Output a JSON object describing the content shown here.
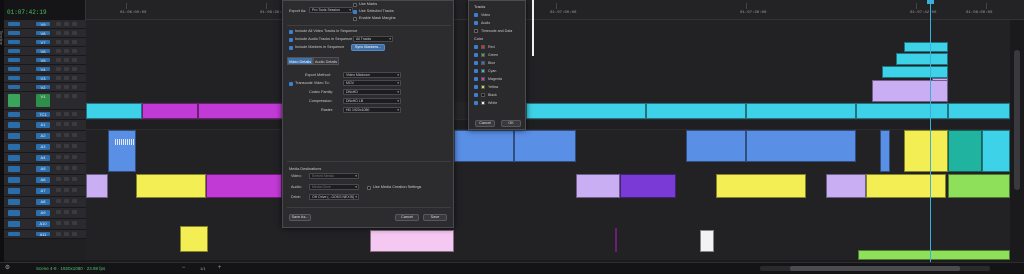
{
  "app": {
    "sidebar_label": "Timeline",
    "timecode": "01:07:42:19",
    "status_text": "Scene 4-8 · 1920x1080 · 23.98 fps",
    "zoom_value": "1/1"
  },
  "ruler": {
    "labels": [
      "01:06:00:00",
      "01:06:30:00",
      "01:07:00:00",
      "01:07:30:00",
      "01:07:42:00",
      "01:08:00:00"
    ]
  },
  "tracks": [
    {
      "name": "V9",
      "kind": "video"
    },
    {
      "name": "V8",
      "kind": "video"
    },
    {
      "name": "V7",
      "kind": "video"
    },
    {
      "name": "V6",
      "kind": "video"
    },
    {
      "name": "V5",
      "kind": "video"
    },
    {
      "name": "V4",
      "kind": "video"
    },
    {
      "name": "V3",
      "kind": "video"
    },
    {
      "name": "V2",
      "kind": "video"
    },
    {
      "name": "V1",
      "kind": "video"
    },
    {
      "name": "TC1",
      "kind": "timecode"
    },
    {
      "name": "A1",
      "kind": "audio"
    },
    {
      "name": "A2",
      "kind": "audio"
    },
    {
      "name": "A3",
      "kind": "audio"
    },
    {
      "name": "A4",
      "kind": "audio"
    },
    {
      "name": "A5",
      "kind": "audio"
    },
    {
      "name": "A6",
      "kind": "audio"
    },
    {
      "name": "A7",
      "kind": "audio"
    },
    {
      "name": "A8",
      "kind": "audio"
    },
    {
      "name": "A9",
      "kind": "audio"
    },
    {
      "name": "A10",
      "kind": "audio"
    },
    {
      "name": "A11",
      "kind": "audio"
    }
  ],
  "dialog": {
    "export_as_label": "Export As:",
    "export_as_value": "Pro Tools Session",
    "use_marks": "Use Marks",
    "use_selected_tracks": "Use Selected Tracks",
    "enable_mask_margins": "Enable Mask Margins",
    "include_video": "Include All Video Tracks in Sequence",
    "include_audio": "Include Audio Tracks in Sequence",
    "audio_tracks_value": "All Tracks",
    "include_markers": "Include Markers in Sequence",
    "sync_markers_button": "Sync Markers...",
    "tab_video": "Video Details",
    "tab_audio": "Audio Details",
    "export_method_label": "Export Method:",
    "export_method_value": "Video Mixdown",
    "transcode_label": "Transcode Video To:",
    "transcode_value": "MOV",
    "codec_family_label": "Codec Family:",
    "codec_family_value": "DNxHD",
    "compression_label": "Compression:",
    "compression_value": "DNxHD LB",
    "raster_label": "Raster:",
    "raster_value": "HD 1920x1080",
    "media_dest_label": "Media Destinations",
    "video_dest_label": "Video:",
    "video_dest_value": "Embed Media",
    "audio_dest_label": "Audio:",
    "audio_dest_value": "Media Drive",
    "drive_label": "Drive:",
    "drive_value": "OH Drive (...OOKS NEXIS)",
    "use_media_creation": "Use Media Creation Settings",
    "save_as_button": "Save As...",
    "cancel_button": "Cancel",
    "save_button": "Save"
  },
  "popup": {
    "tracks_header": "Tracks",
    "tracks": [
      {
        "label": "Video",
        "checked": true
      },
      {
        "label": "Audio",
        "checked": true
      },
      {
        "label": "Timecode and Data",
        "checked": false
      }
    ],
    "color_header": "Color",
    "colors": [
      {
        "label": "Red",
        "checked": true,
        "swatch": "#d03838"
      },
      {
        "label": "Green",
        "checked": true,
        "swatch": "#3ab04a"
      },
      {
        "label": "Blue",
        "checked": true,
        "swatch": "#3a6cd0"
      },
      {
        "label": "Cyan",
        "checked": true,
        "swatch": "#32c4cc"
      },
      {
        "label": "Magenta",
        "checked": true,
        "swatch": "#c83cc8"
      },
      {
        "label": "Yellow",
        "checked": true,
        "swatch": "#e0d83a"
      },
      {
        "label": "Black",
        "checked": true,
        "swatch": "#111111"
      },
      {
        "label": "White",
        "checked": true,
        "swatch": "#f0f0f0"
      }
    ],
    "cancel_button": "Cancel",
    "ok_button": "OK"
  },
  "colors": {
    "accent_blue": "#3e6fa6",
    "playhead": "#3ab0d8",
    "clip_cyan": "#3ed2e8",
    "clip_magenta": "#c23ad6",
    "clip_yellow": "#f2ee54",
    "clip_lavender": "#c9aef4",
    "clip_green": "#8ee05a",
    "clip_blue": "#5a8fe6",
    "clip_teal": "#1fb3a0"
  }
}
